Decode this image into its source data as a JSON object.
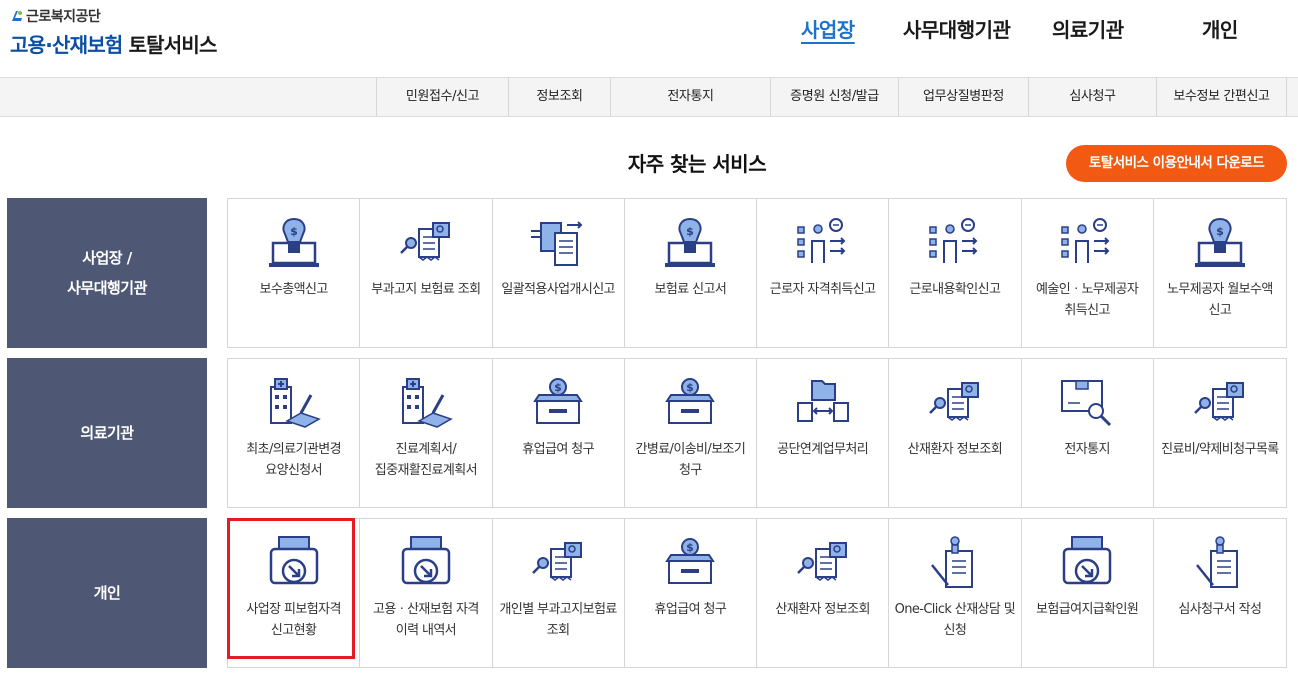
{
  "header": {
    "org_name": "근로복지공단",
    "service_name_blue": "고용·산재보험",
    "service_name_dark": "토탈서비스",
    "nav": [
      {
        "label": "사업장",
        "active": true
      },
      {
        "label": "사무대행기관",
        "active": false
      },
      {
        "label": "의료기관",
        "active": false
      },
      {
        "label": "개인",
        "active": false
      }
    ]
  },
  "submenu": [
    "민원접수/신고",
    "정보조회",
    "전자통지",
    "증명원 신청/발급",
    "업무상질병판정",
    "심사청구",
    "보수정보 간편신고"
  ],
  "section_title": "자주 찾는 서비스",
  "guide_button": "토탈서비스 이용안내서 다운로드",
  "colors": {
    "category_bg": "#4e5875",
    "accent_orange": "#f25a14",
    "active_nav": "#1e73c8",
    "highlight_red": "#e8191f",
    "icon_blue": "#2a3f85"
  },
  "rows": [
    {
      "category": [
        "사업장 /",
        "사무대행기관"
      ],
      "items": [
        {
          "label": "보수총액신고",
          "icon": "money-laptop-icon"
        },
        {
          "label": "부과고지 보험료 조회",
          "icon": "document-search-icon"
        },
        {
          "label": "일괄적용사업개시신고",
          "icon": "document-transfer-icon"
        },
        {
          "label": "보험료 신고서",
          "icon": "money-laptop-icon"
        },
        {
          "label": "근로자 자격취득신고",
          "icon": "person-list-icon"
        },
        {
          "label": "근로내용확인신고",
          "icon": "person-list-icon"
        },
        {
          "label": "예술인ㆍ노무제공자 취득신고",
          "icon": "person-list-icon"
        },
        {
          "label": "노무제공자 월보수액 신고",
          "icon": "money-laptop-icon"
        }
      ]
    },
    {
      "category": [
        "의료기관"
      ],
      "items": [
        {
          "label": "최초/의료기관변경 요양신청서",
          "icon": "hospital-document-icon"
        },
        {
          "label": "진료계획서/집중재활진료계획서",
          "icon": "hospital-document-icon"
        },
        {
          "label": "휴업급여 청구",
          "icon": "money-box-icon"
        },
        {
          "label": "간병료/이송비/보조기 청구",
          "icon": "money-box-icon"
        },
        {
          "label": "공단연계업무처리",
          "icon": "folder-exchange-icon"
        },
        {
          "label": "산재환자 정보조회",
          "icon": "document-search-icon"
        },
        {
          "label": "전자통지",
          "icon": "monitor-search-icon"
        },
        {
          "label": "진료비/약제비청구목록",
          "icon": "document-search-icon"
        }
      ]
    },
    {
      "category": [
        "개인"
      ],
      "items": [
        {
          "label": "사업장 피보험자격 신고현황",
          "icon": "printer-download-icon"
        },
        {
          "label": "고용ㆍ산재보험 자격 이력 내역서",
          "icon": "printer-download-icon"
        },
        {
          "label": "개인별 부과고지보험료 조회",
          "icon": "document-search-icon"
        },
        {
          "label": "휴업급여 청구",
          "icon": "money-box-icon"
        },
        {
          "label": "산재환자 정보조회",
          "icon": "document-search-icon"
        },
        {
          "label": "One-Click 산재상담 및 신청",
          "icon": "stamp-document-icon"
        },
        {
          "label": "보험급여지급확인원",
          "icon": "printer-download-icon"
        },
        {
          "label": "심사청구서 작성",
          "icon": "stamp-document-icon"
        }
      ]
    }
  ]
}
